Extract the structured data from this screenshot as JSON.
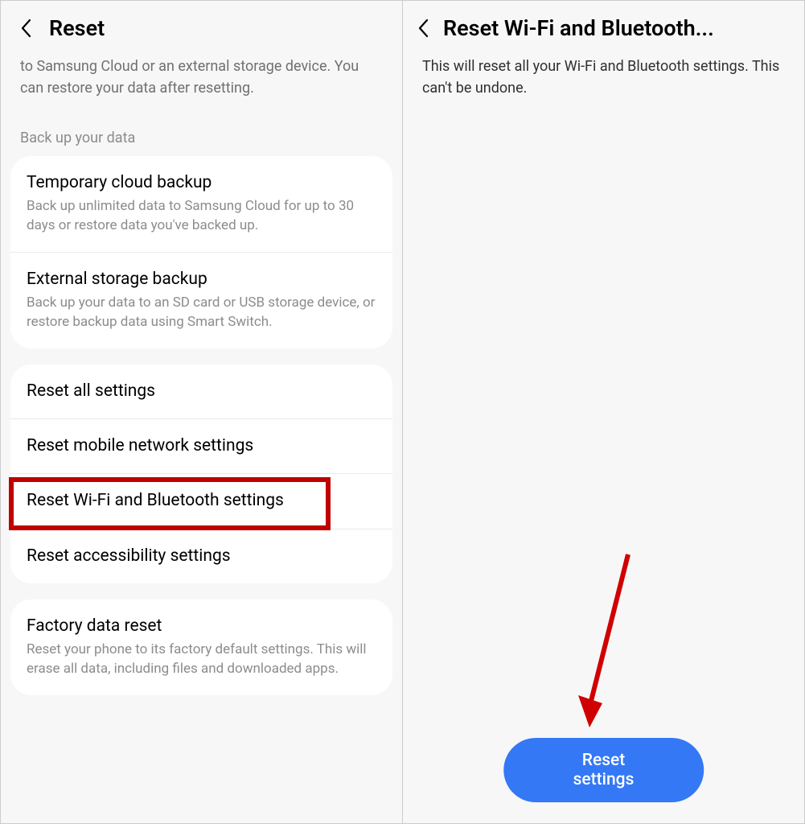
{
  "left": {
    "title": "Reset",
    "intro": "to Samsung Cloud or an external storage device. You can restore your data after resetting.",
    "sectionLabel": "Back up your data",
    "backupItems": [
      {
        "title": "Temporary cloud backup",
        "desc": "Back up unlimited data to Samsung Cloud for up to 30 days or restore data you've backed up."
      },
      {
        "title": "External storage backup",
        "desc": "Back up your data to an SD card or USB storage device, or restore backup data using Smart Switch."
      }
    ],
    "resetItems": [
      {
        "title": "Reset all settings"
      },
      {
        "title": "Reset mobile network settings"
      },
      {
        "title": "Reset Wi-Fi and Bluetooth settings",
        "highlighted": true
      },
      {
        "title": "Reset accessibility settings"
      }
    ],
    "factoryItem": {
      "title": "Factory data reset",
      "desc": "Reset your phone to its factory default settings. This will erase all data, including files and downloaded apps."
    }
  },
  "right": {
    "title": "Reset Wi-Fi and Bluetooth...",
    "description": "This will reset all your Wi-Fi and Bluetooth settings. This can't be undone.",
    "buttonLabel": "Reset settings"
  }
}
